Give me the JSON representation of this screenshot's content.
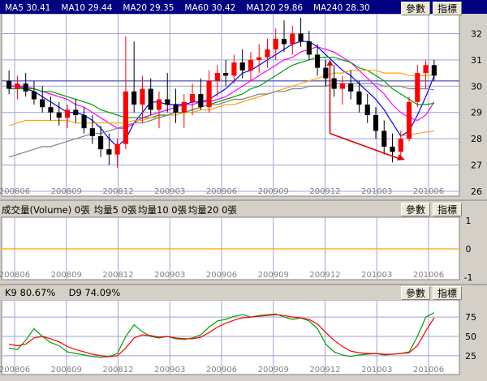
{
  "colors": {
    "background": "#ffffff",
    "header_bg": "#000080",
    "grid": "#a0a0d8",
    "axis_text": "#000000",
    "candle_up": "#ff0000",
    "candle_down": "#000000",
    "ma5": "#0000ff",
    "ma10": "#ff00ff",
    "ma20": "#00a000",
    "ma60": "#ffa500",
    "ma120": "#808080",
    "ma240": "#ffa040",
    "k_line": "#00a000",
    "d_line": "#ff0000",
    "annotation": "#e00000",
    "volume_zero_line": "#ffa500"
  },
  "buttons": {
    "params": "參數",
    "indicator": "指標"
  },
  "chart_data": [
    {
      "type": "line",
      "panel": "price",
      "header": [
        {
          "label": "MA5",
          "value": "30.41",
          "color": "#ffffff"
        },
        {
          "label": "MA10",
          "value": "29.44",
          "color": "#ffffff"
        },
        {
          "label": "MA20",
          "value": "29.35",
          "color": "#ffffff"
        },
        {
          "label": "MA60",
          "value": "30.42",
          "color": "#ffffff"
        },
        {
          "label": "MA120",
          "value": "29.86",
          "color": "#ffffff"
        },
        {
          "label": "MA240",
          "value": "28.30",
          "color": "#ffffff"
        }
      ],
      "x_ticks": [
        "200806",
        "200809",
        "200812",
        "200903",
        "200906",
        "200909",
        "200912",
        "201003",
        "201006"
      ],
      "y_ticks": [
        26,
        27,
        28,
        29,
        30,
        31,
        32
      ],
      "ylim": [
        26,
        32.6
      ],
      "reference_line": 30.2,
      "candles": [
        {
          "o": 30.2,
          "h": 30.6,
          "l": 29.7,
          "c": 29.9
        },
        {
          "o": 29.9,
          "h": 30.4,
          "l": 29.5,
          "c": 30.1
        },
        {
          "o": 30.1,
          "h": 30.5,
          "l": 29.6,
          "c": 29.8
        },
        {
          "o": 29.8,
          "h": 30.2,
          "l": 29.3,
          "c": 29.5
        },
        {
          "o": 29.5,
          "h": 30.0,
          "l": 29.0,
          "c": 29.2
        },
        {
          "o": 29.2,
          "h": 29.6,
          "l": 28.7,
          "c": 29.0
        },
        {
          "o": 29.0,
          "h": 29.4,
          "l": 28.5,
          "c": 28.8
        },
        {
          "o": 28.8,
          "h": 29.3,
          "l": 28.4,
          "c": 29.1
        },
        {
          "o": 29.1,
          "h": 29.5,
          "l": 28.6,
          "c": 28.9
        },
        {
          "o": 28.9,
          "h": 29.2,
          "l": 28.2,
          "c": 28.4
        },
        {
          "o": 28.4,
          "h": 28.9,
          "l": 27.8,
          "c": 28.1
        },
        {
          "o": 28.1,
          "h": 28.5,
          "l": 27.3,
          "c": 27.6
        },
        {
          "o": 27.6,
          "h": 28.2,
          "l": 27.0,
          "c": 27.4
        },
        {
          "o": 27.4,
          "h": 28.0,
          "l": 26.9,
          "c": 27.8
        },
        {
          "o": 27.8,
          "h": 31.9,
          "l": 27.6,
          "c": 29.8
        },
        {
          "o": 29.8,
          "h": 31.7,
          "l": 29.0,
          "c": 29.3
        },
        {
          "o": 29.3,
          "h": 30.4,
          "l": 28.6,
          "c": 29.9
        },
        {
          "o": 29.9,
          "h": 30.3,
          "l": 28.9,
          "c": 29.1
        },
        {
          "o": 29.1,
          "h": 29.8,
          "l": 28.4,
          "c": 29.5
        },
        {
          "o": 29.5,
          "h": 30.5,
          "l": 29.0,
          "c": 29.3
        },
        {
          "o": 29.3,
          "h": 29.9,
          "l": 28.6,
          "c": 29.0
        },
        {
          "o": 29.0,
          "h": 29.7,
          "l": 28.4,
          "c": 29.4
        },
        {
          "o": 29.4,
          "h": 30.1,
          "l": 28.9,
          "c": 29.7
        },
        {
          "o": 29.7,
          "h": 30.3,
          "l": 29.1,
          "c": 29.2
        },
        {
          "o": 29.2,
          "h": 30.6,
          "l": 29.0,
          "c": 30.2
        },
        {
          "o": 30.2,
          "h": 30.8,
          "l": 29.6,
          "c": 30.5
        },
        {
          "o": 30.5,
          "h": 31.0,
          "l": 30.0,
          "c": 30.4
        },
        {
          "o": 30.4,
          "h": 31.2,
          "l": 30.1,
          "c": 30.9
        },
        {
          "o": 30.9,
          "h": 31.4,
          "l": 30.3,
          "c": 30.6
        },
        {
          "o": 30.6,
          "h": 31.3,
          "l": 30.2,
          "c": 31.0
        },
        {
          "o": 31.0,
          "h": 31.6,
          "l": 30.5,
          "c": 31.1
        },
        {
          "o": 31.1,
          "h": 31.8,
          "l": 30.7,
          "c": 31.4
        },
        {
          "o": 31.4,
          "h": 32.2,
          "l": 31.0,
          "c": 31.8
        },
        {
          "o": 31.8,
          "h": 32.5,
          "l": 31.3,
          "c": 31.6
        },
        {
          "o": 31.6,
          "h": 32.3,
          "l": 31.2,
          "c": 32.0
        },
        {
          "o": 32.0,
          "h": 32.6,
          "l": 31.5,
          "c": 31.7
        },
        {
          "o": 31.7,
          "h": 32.1,
          "l": 31.0,
          "c": 31.2
        },
        {
          "o": 31.2,
          "h": 31.6,
          "l": 30.4,
          "c": 30.7
        },
        {
          "o": 30.7,
          "h": 31.0,
          "l": 30.0,
          "c": 30.3
        },
        {
          "o": 30.3,
          "h": 30.8,
          "l": 29.6,
          "c": 29.9
        },
        {
          "o": 29.9,
          "h": 30.4,
          "l": 29.3,
          "c": 30.1
        },
        {
          "o": 30.1,
          "h": 30.6,
          "l": 29.5,
          "c": 29.8
        },
        {
          "o": 29.8,
          "h": 30.2,
          "l": 29.0,
          "c": 29.3
        },
        {
          "o": 29.3,
          "h": 29.7,
          "l": 28.6,
          "c": 28.9
        },
        {
          "o": 28.9,
          "h": 29.2,
          "l": 28.0,
          "c": 28.3
        },
        {
          "o": 28.3,
          "h": 28.7,
          "l": 27.4,
          "c": 27.7
        },
        {
          "o": 27.7,
          "h": 28.2,
          "l": 27.1,
          "c": 27.5
        },
        {
          "o": 27.5,
          "h": 28.3,
          "l": 27.2,
          "c": 28.0
        },
        {
          "o": 28.0,
          "h": 29.6,
          "l": 27.9,
          "c": 29.4
        },
        {
          "o": 29.4,
          "h": 30.8,
          "l": 29.2,
          "c": 30.5
        },
        {
          "o": 30.5,
          "h": 31.0,
          "l": 29.9,
          "c": 30.8
        },
        {
          "o": 30.8,
          "h": 31.0,
          "l": 30.2,
          "c": 30.4
        }
      ],
      "ma_lines": [
        {
          "key": "ma5",
          "values": [
            30.0,
            30.0,
            29.9,
            29.8,
            29.6,
            29.4,
            29.2,
            29.0,
            29.0,
            28.9,
            28.7,
            28.4,
            28.0,
            27.7,
            28.0,
            28.6,
            29.0,
            29.4,
            29.4,
            29.3,
            29.3,
            29.3,
            29.4,
            29.4,
            29.5,
            29.7,
            29.9,
            30.2,
            30.5,
            30.6,
            30.8,
            31.0,
            31.2,
            31.4,
            31.6,
            31.7,
            31.7,
            31.5,
            31.2,
            30.9,
            30.6,
            30.4,
            30.1,
            29.8,
            29.5,
            29.1,
            28.6,
            28.1,
            28.3,
            28.9,
            29.6,
            30.4
          ]
        },
        {
          "key": "ma10",
          "values": [
            30.0,
            30.0,
            30.0,
            29.9,
            29.8,
            29.7,
            29.6,
            29.5,
            29.3,
            29.2,
            29.0,
            28.8,
            28.6,
            28.4,
            28.4,
            28.6,
            28.8,
            28.9,
            29.0,
            29.1,
            29.2,
            29.3,
            29.3,
            29.4,
            29.4,
            29.5,
            29.6,
            29.8,
            30.0,
            30.2,
            30.4,
            30.6,
            30.8,
            31.0,
            31.1,
            31.3,
            31.4,
            31.5,
            31.4,
            31.3,
            31.1,
            30.9,
            30.6,
            30.3,
            30.0,
            29.7,
            29.3,
            29.0,
            28.8,
            28.7,
            28.9,
            29.4
          ]
        },
        {
          "key": "ma20",
          "values": [
            29.9,
            29.9,
            29.9,
            29.9,
            29.8,
            29.8,
            29.7,
            29.6,
            29.5,
            29.4,
            29.3,
            29.1,
            29.0,
            28.9,
            28.8,
            28.8,
            28.8,
            28.8,
            28.9,
            28.9,
            29.0,
            29.0,
            29.1,
            29.2,
            29.3,
            29.4,
            29.5,
            29.6,
            29.7,
            29.9,
            30.0,
            30.2,
            30.4,
            30.6,
            30.8,
            30.9,
            31.0,
            31.1,
            31.1,
            31.1,
            31.0,
            30.9,
            30.7,
            30.6,
            30.4,
            30.2,
            29.9,
            29.7,
            29.5,
            29.3,
            29.3,
            29.35
          ]
        },
        {
          "key": "ma60",
          "values": [
            28.5,
            28.6,
            28.7,
            28.7,
            28.7,
            28.7,
            28.7,
            28.7,
            28.6,
            28.6,
            28.6,
            28.6,
            28.6,
            28.6,
            28.6,
            28.7,
            28.7,
            28.8,
            28.8,
            28.9,
            28.9,
            29.0,
            29.0,
            29.1,
            29.1,
            29.2,
            29.3,
            29.3,
            29.4,
            29.5,
            29.6,
            29.7,
            29.8,
            29.9,
            30.0,
            30.1,
            30.2,
            30.3,
            30.4,
            30.5,
            30.5,
            30.6,
            30.6,
            30.6,
            30.6,
            30.5,
            30.5,
            30.5,
            30.4,
            30.4,
            30.4,
            30.42
          ]
        },
        {
          "key": "ma120",
          "values": [
            27.3,
            27.4,
            27.5,
            27.6,
            27.7,
            27.7,
            27.8,
            27.9,
            28.0,
            28.1,
            28.2,
            28.2,
            28.3,
            28.4,
            28.5,
            28.6,
            28.6,
            28.7,
            28.8,
            28.9,
            29.0,
            29.0,
            29.1,
            29.2,
            29.3,
            29.3,
            29.4,
            29.5,
            29.5,
            29.6,
            29.7,
            29.7,
            29.8,
            29.8,
            29.9,
            29.9,
            30.0,
            30.0,
            30.0,
            30.1,
            30.1,
            30.1,
            30.1,
            30.1,
            30.1,
            30.0,
            30.0,
            30.0,
            29.9,
            29.9,
            29.9,
            29.86
          ]
        },
        {
          "key": "ma240",
          "values": [
            null,
            null,
            null,
            null,
            null,
            null,
            null,
            null,
            null,
            null,
            null,
            null,
            null,
            null,
            null,
            null,
            null,
            null,
            null,
            null,
            null,
            null,
            null,
            null,
            null,
            null,
            null,
            null,
            null,
            null,
            null,
            null,
            null,
            null,
            null,
            null,
            null,
            null,
            null,
            null,
            null,
            null,
            null,
            null,
            null,
            null,
            null,
            28.1,
            28.15,
            28.2,
            28.25,
            28.3
          ]
        }
      ],
      "annotation": {
        "up_arrow": {
          "from_i": 38.5,
          "from_y": 28.2,
          "to_i": 38.5,
          "to_y": 31.0
        },
        "down_arrow": {
          "from_i": 38.5,
          "from_y": 28.2,
          "to_i": 47.5,
          "to_y": 27.2
        }
      }
    },
    {
      "type": "bar",
      "panel": "volume",
      "header": [
        {
          "label": "成交量(Volume)",
          "value": "0張"
        },
        {
          "label": "均量5",
          "value": "0張"
        },
        {
          "label": "均量10",
          "value": "0張"
        },
        {
          "label": "均量20",
          "value": "0張"
        }
      ],
      "x_ticks": [
        "200806",
        "200809",
        "200812",
        "200903",
        "200906",
        "200909",
        "200912",
        "201003",
        "201006"
      ],
      "y_ticks": [
        1,
        0,
        -1
      ],
      "ylim": [
        -1,
        1
      ],
      "values": [
        0
      ]
    },
    {
      "type": "line",
      "panel": "kd",
      "header": [
        {
          "label": "K9",
          "value": "80.67%"
        },
        {
          "label": "D9",
          "value": "74.09%"
        }
      ],
      "x_ticks": [
        "200806",
        "200809",
        "200812",
        "200903",
        "200906",
        "200909",
        "200912",
        "201003",
        "201006"
      ],
      "y_ticks": [
        75,
        50,
        25
      ],
      "ylim": [
        5,
        95
      ],
      "series": [
        {
          "key": "k_line",
          "values": [
            35,
            33,
            45,
            60,
            50,
            42,
            38,
            30,
            28,
            26,
            24,
            23,
            24,
            28,
            50,
            65,
            56,
            50,
            48,
            50,
            47,
            46,
            48,
            52,
            62,
            70,
            72,
            76,
            78,
            75,
            77,
            78,
            79,
            75,
            72,
            74,
            70,
            60,
            40,
            30,
            26,
            24,
            26,
            27,
            28,
            26,
            27,
            28,
            30,
            50,
            75,
            80.67
          ]
        },
        {
          "key": "d_line",
          "values": [
            40,
            38,
            40,
            48,
            50,
            47,
            43,
            37,
            33,
            30,
            27,
            25,
            24,
            25,
            35,
            48,
            52,
            51,
            49,
            50,
            48,
            47,
            47,
            49,
            55,
            62,
            67,
            71,
            74,
            75,
            76,
            77,
            78,
            77,
            75,
            74,
            72,
            66,
            55,
            45,
            37,
            31,
            29,
            28,
            28,
            27,
            27,
            28,
            29,
            38,
            57,
            74.09
          ]
        }
      ]
    }
  ]
}
